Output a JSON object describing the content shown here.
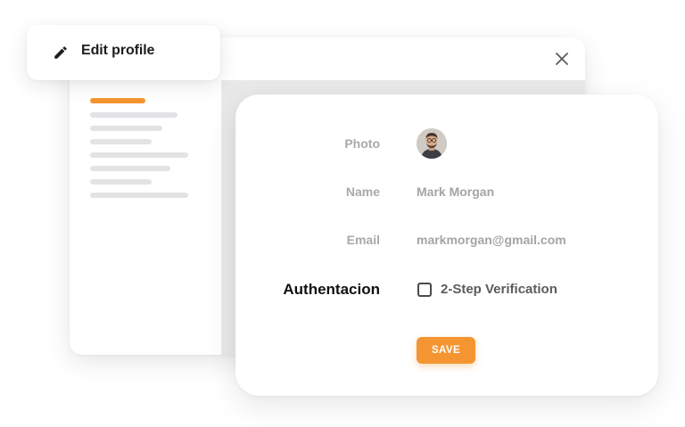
{
  "header": {
    "title": "Edit profile",
    "edit_icon": "pencil-icon",
    "close_icon": "close-icon"
  },
  "profile": {
    "photo_label": "Photo",
    "name_label": "Name",
    "name_value": "Mark Morgan",
    "email_label": "Email",
    "email_value": "markmorgan@gmail.com",
    "auth_label": "Authentacion",
    "two_step_label": "2-Step Verification",
    "two_step_checked": false,
    "save_label": "SAVE"
  },
  "colors": {
    "accent": "#f59532",
    "nav_placeholder": "#e3e3e5",
    "panel_gray": "#e9e9ea"
  }
}
